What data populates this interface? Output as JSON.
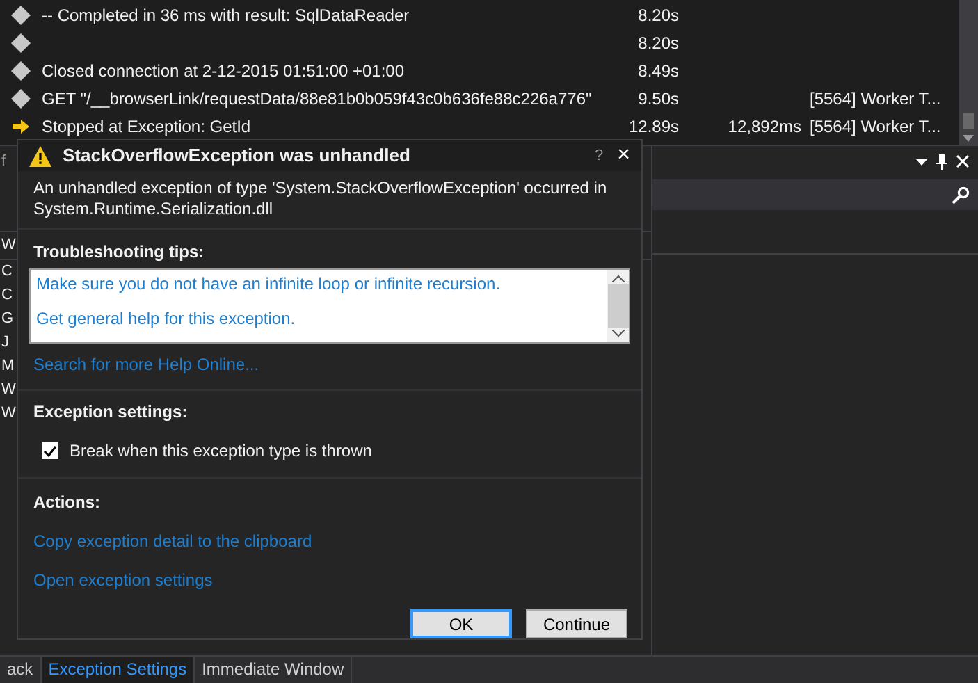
{
  "events": [
    {
      "kind": "diamond",
      "description": "-- Completed in 36 ms with result: SqlDataReader",
      "time": "8.20s"
    },
    {
      "kind": "diamond",
      "time": "8.20s"
    },
    {
      "kind": "diamond",
      "description": "Closed connection at 2-12-2015 01:51:00 +01:00",
      "time": "8.49s"
    },
    {
      "kind": "diamond",
      "description": "GET \"/__browserLink/requestData/88e81b0b059f43c0b636fe88c226a776\"",
      "time": "9.50s",
      "thread": "[5564] Worker T..."
    },
    {
      "kind": "arrow",
      "description": "Stopped at Exception: GetId",
      "time": "12.89s",
      "duration": "12,892ms",
      "thread": "[5564] Worker T..."
    }
  ],
  "left_panel": {
    "header": "f",
    "title": "W",
    "items": [
      "C",
      "C",
      "G",
      "J",
      "M",
      "W",
      "W"
    ]
  },
  "dialog": {
    "title": "StackOverflowException was unhandled",
    "help": "?",
    "close": "×",
    "message": "An unhandled exception of type 'System.StackOverflowException' occurred in System.Runtime.Serialization.dll",
    "tips_heading": "Troubleshooting tips:",
    "tips": [
      "Make sure you do not have an infinite loop or infinite recursion.",
      "Get general help for this exception."
    ],
    "search_link": "Search for more Help Online...",
    "settings_heading": "Exception settings:",
    "break_option": {
      "label": "Break when this exception type is thrown",
      "checked": true
    },
    "actions_heading": "Actions:",
    "actions": [
      "Copy exception detail to the clipboard",
      "Open exception settings"
    ],
    "buttons": [
      {
        "label": "OK",
        "selected": true
      },
      {
        "label": "Continue",
        "selected": false
      }
    ]
  },
  "bottom_tabs": [
    {
      "label": "ack",
      "selected": false
    },
    {
      "label": "Exception Settings",
      "selected": true
    },
    {
      "label": "Immediate Window",
      "selected": false
    }
  ]
}
